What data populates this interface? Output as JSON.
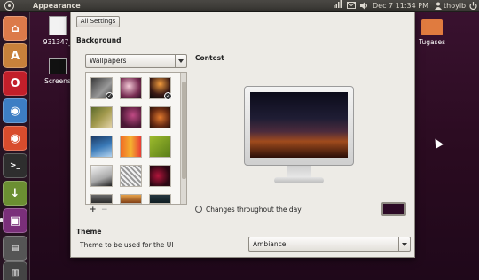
{
  "top_panel": {
    "app_title": "Appearance",
    "clock": "Dec  7 11:34 PM",
    "user": "thoyib"
  },
  "launcher": {
    "items": [
      {
        "icon": "home-folder-icon",
        "color": "#dc7a4a"
      },
      {
        "icon": "software-center-icon",
        "color": "#c8813b"
      },
      {
        "icon": "opera-icon",
        "color": "#c21f2a"
      },
      {
        "icon": "chromium-icon",
        "color": "#3d7ec4"
      },
      {
        "icon": "chrome-icon",
        "color": "#d84c2d"
      },
      {
        "icon": "terminal-icon",
        "color": "#2e2e2e"
      },
      {
        "icon": "installer-icon",
        "color": "#6b8f32"
      },
      {
        "icon": "appearance-icon",
        "color": "#7a2f7a"
      },
      {
        "icon": "system-monitor-icon",
        "color": "#555"
      },
      {
        "icon": "trash-icon",
        "color": "#444"
      }
    ]
  },
  "desktop": {
    "icons": [
      {
        "label": "931347_"
      },
      {
        "label": "Screens"
      },
      {
        "label": "Tugases"
      }
    ]
  },
  "dialog": {
    "all_settings": "All Settings",
    "background_heading": "Background",
    "wallpaper_mode": "Wallpapers",
    "contest_label": "Contest",
    "changes_label": "Changes throughout the day",
    "add_label": "+",
    "remove_label": "−",
    "theme_heading": "Theme",
    "theme_label": "Theme to be used for the UI",
    "theme_value": "Ambiance",
    "swatch_color": "#2c0a26"
  },
  "thumbnails": [
    {
      "color": "linear-gradient(135deg,#3a3a3a,#999 60%,#444)",
      "selected": true
    },
    {
      "color": "radial-gradient(circle at 40% 40%,#f3c9d6,#7a2f55 60%,#2b0f23)",
      "selected": false
    },
    {
      "color": "radial-gradient(circle at 50% 30%,#f09a3c,#3a1a14 60%,#090909)",
      "selected": true
    },
    {
      "color": "linear-gradient(135deg,#5d6b2c,#a39a4e,#e2d2a6)",
      "selected": false
    },
    {
      "color": "radial-gradient(circle at 60% 40%,#c04a84,#4a1734 70%)",
      "selected": false
    },
    {
      "color": "radial-gradient(circle at 50% 50%,#e0792d,#6a2c13 60%,#2a130b)",
      "selected": false
    },
    {
      "color": "linear-gradient(160deg,#1d3c66,#3a7ab8 50%,#b2d3f0)",
      "selected": false
    },
    {
      "color": "linear-gradient(90deg,#f06b25,#f4b12f,#e93c34)",
      "selected": false
    },
    {
      "color": "linear-gradient(135deg,#9dbb2d,#5a7d18)",
      "selected": false
    },
    {
      "color": "linear-gradient(160deg,#f6f6f6,#a9a9a9 60%,#222)",
      "selected": false
    },
    {
      "color": "repeating-linear-gradient(45deg,#f2f2f2 0 2px,#999 2px 4px)",
      "selected": false
    },
    {
      "color": "radial-gradient(circle at 40% 50%,#b0153b,#2a0612 70%)",
      "selected": false
    },
    {
      "color": "linear-gradient(180deg,#6a6a6a,#2c2c2c)",
      "selected": false
    },
    {
      "color": "linear-gradient(180deg,#e7a24a,#813f16)",
      "selected": false
    },
    {
      "color": "linear-gradient(180deg,#25363f,#0f1d22)",
      "selected": false
    }
  ]
}
